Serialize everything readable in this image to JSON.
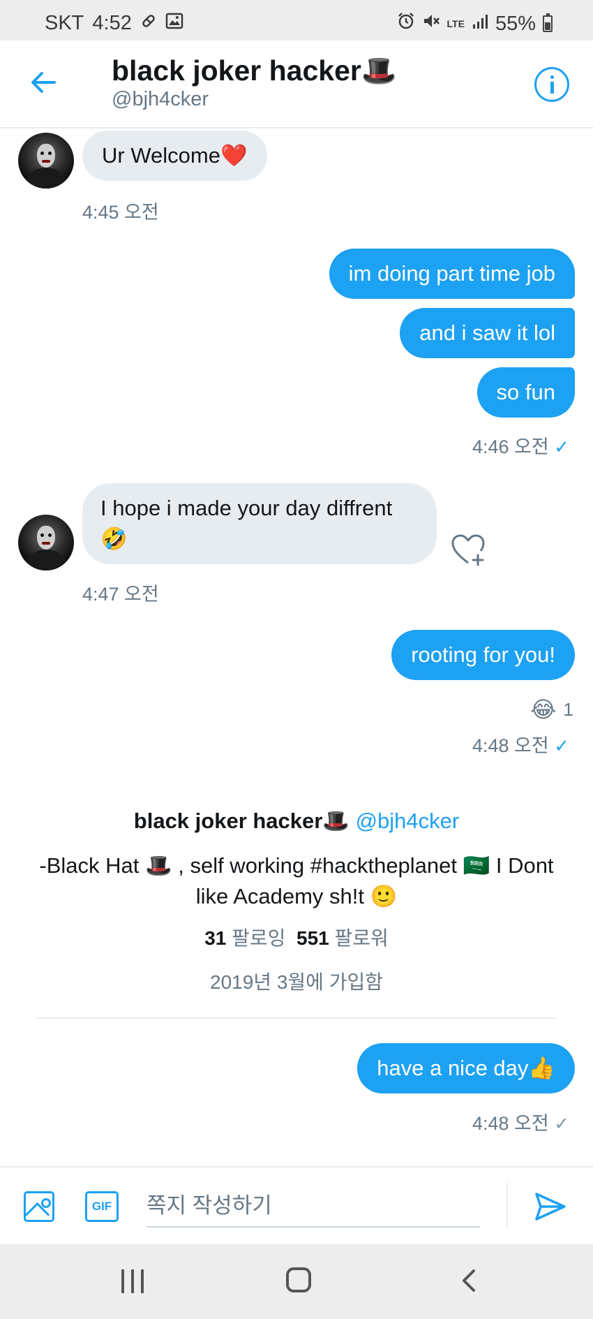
{
  "status_bar": {
    "carrier": "SKT",
    "time": "4:52",
    "network": "LTE",
    "battery": "55%"
  },
  "header": {
    "name": "black joker hacker🎩",
    "handle": "@bjh4cker"
  },
  "messages": [
    {
      "side": "in",
      "text": "Ur Welcome❤️"
    },
    {
      "side": "in",
      "time": "4:45 오전"
    },
    {
      "side": "out",
      "text": "im doing part time job"
    },
    {
      "side": "out",
      "text": "and i saw it lol"
    },
    {
      "side": "out",
      "text": "so fun"
    },
    {
      "side": "out",
      "time": "4:46 오전"
    },
    {
      "side": "in",
      "text_line1": "I hope i made your day diffrent",
      "text_line2": "🤣"
    },
    {
      "side": "in",
      "time": "4:47 오전"
    },
    {
      "side": "out",
      "text": "rooting for you!"
    },
    {
      "side": "out",
      "time": "4:48 오전",
      "reaction": "😂",
      "reaction_count": "1"
    },
    {
      "side": "out",
      "text": "have a nice day👍"
    },
    {
      "side": "out",
      "time": "4:48 오전"
    }
  ],
  "profile_card": {
    "name": "black joker hacker🎩",
    "handle": "@bjh4cker",
    "bio_line1": "-Black Hat 🎩 , self working #hacktheplanet 🇸🇦 I Dont",
    "bio_line2": "like Academy sh!t 🙂",
    "following_count": "31",
    "following_label": "팔로잉",
    "followers_count": "551",
    "followers_label": "팔로워",
    "joined": "2019년 3월에 가입함"
  },
  "composer": {
    "gif_label": "GIF",
    "placeholder": "쪽지 작성하기"
  },
  "colors": {
    "accent": "#1da1f2",
    "incoming_bubble": "#e6ecf0",
    "secondary_text": "#657786"
  }
}
